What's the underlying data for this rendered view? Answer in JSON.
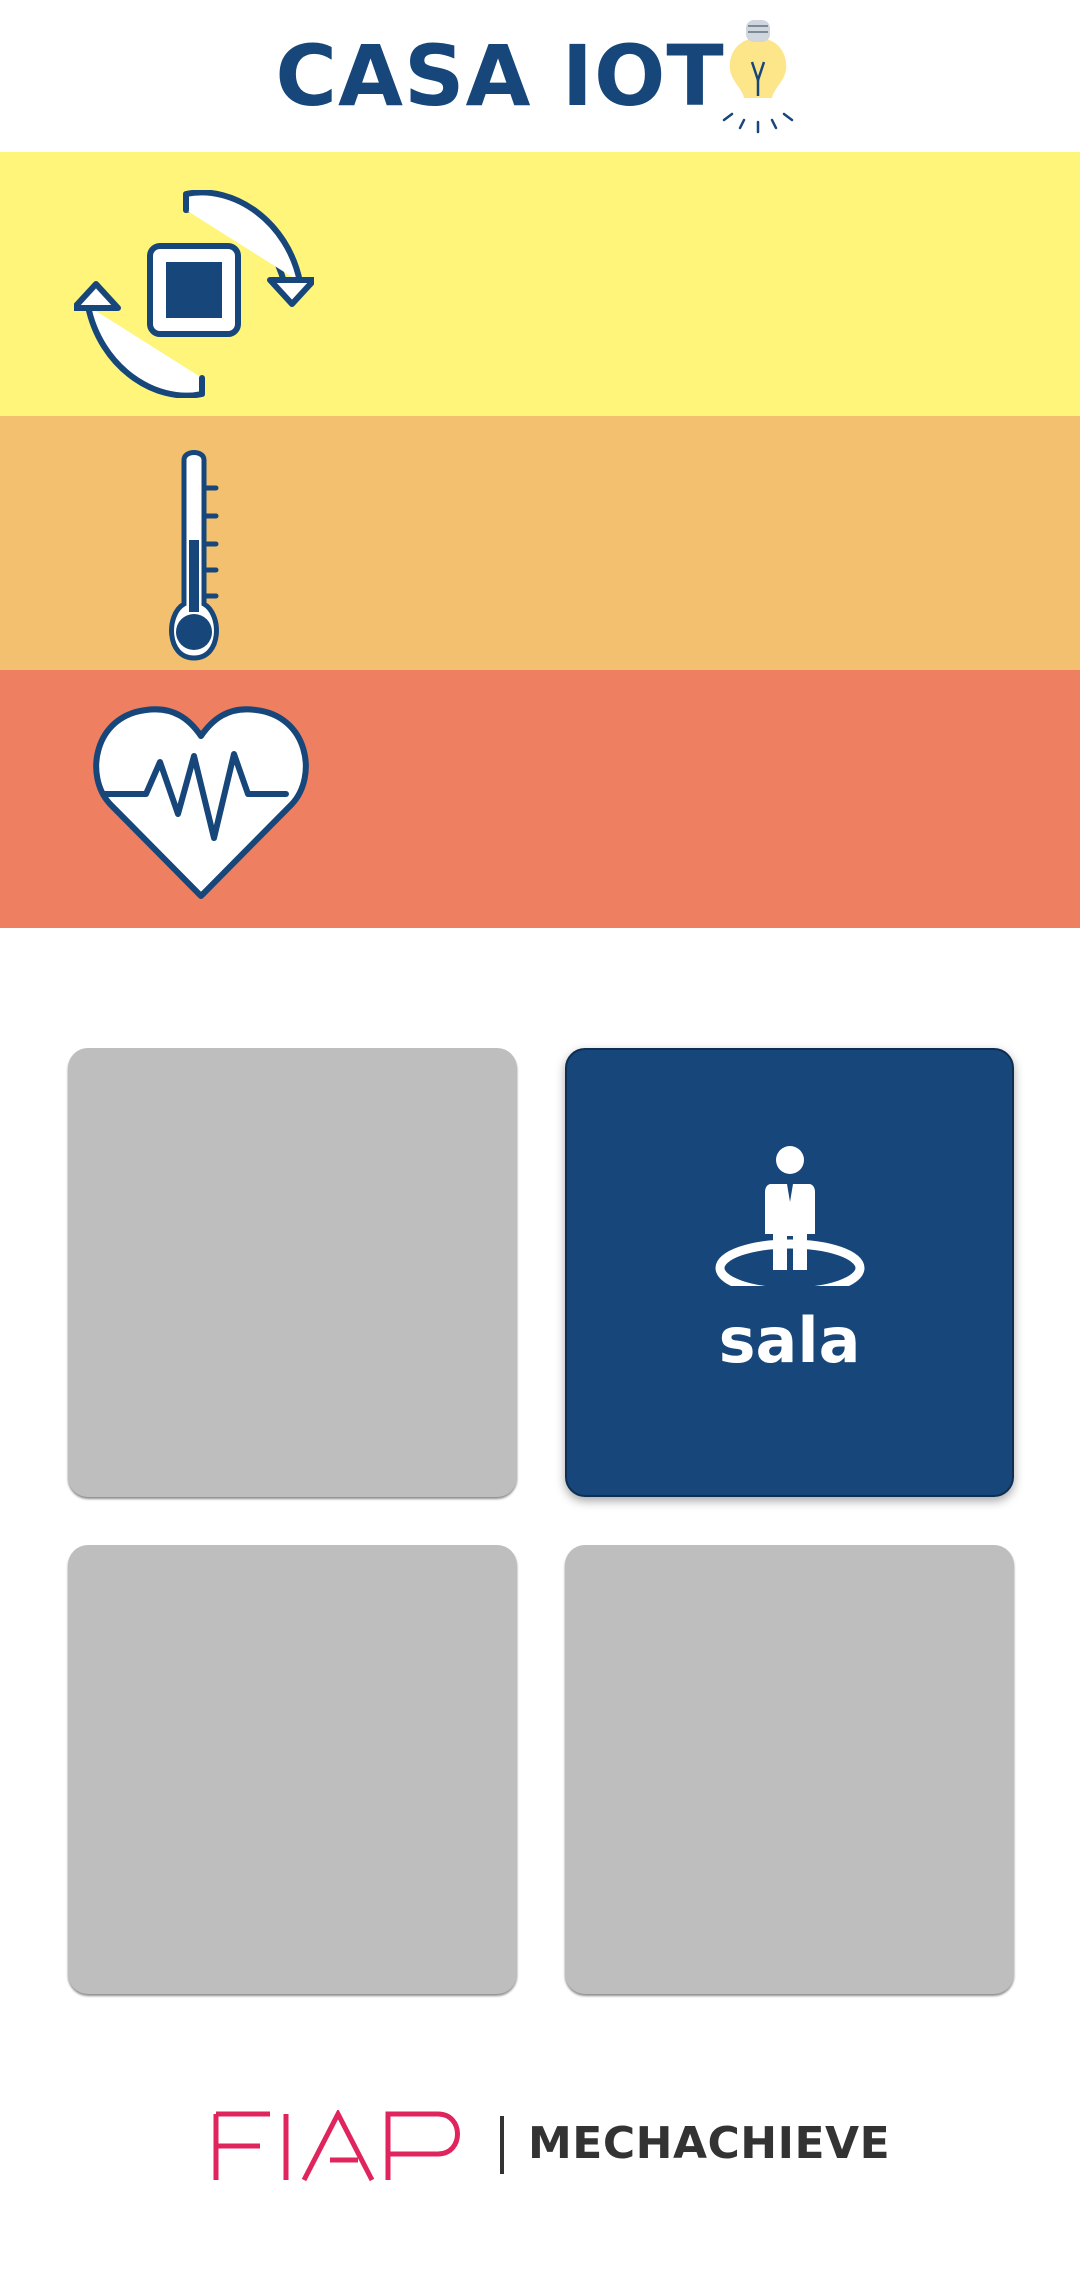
{
  "header": {
    "title": "CASA IOT",
    "title_icon": "light-bulb-icon"
  },
  "bands": [
    {
      "name": "mode",
      "icon": "rotate-stop-icon",
      "color": "#fef57a"
    },
    {
      "name": "temperature",
      "icon": "thermometer-icon",
      "color": "#f2c06e"
    },
    {
      "name": "heart-rate",
      "icon": "heart-pulse-icon",
      "color": "#ee7f60"
    }
  ],
  "rooms": [
    {
      "label": "",
      "active": false,
      "color": "#bebebe"
    },
    {
      "label": "sala",
      "active": true,
      "icon": "person-standing-icon",
      "color": "#17477a"
    },
    {
      "label": "",
      "active": false,
      "color": "#bebebe"
    },
    {
      "label": "",
      "active": false,
      "color": "#bebebe"
    }
  ],
  "footer": {
    "logo_text": "FIAP",
    "brand": "MECHACHIEVE",
    "logo_color": "#e0245e"
  },
  "colors": {
    "primary": "#17477a",
    "tile_inactive": "#bebebe"
  }
}
